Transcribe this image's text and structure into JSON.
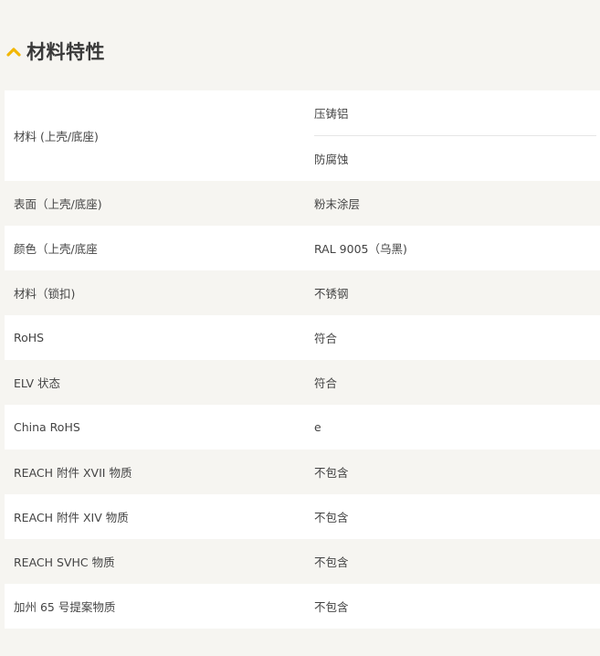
{
  "section": {
    "title": "材料特性",
    "icon": "chevron-up-icon",
    "accent_color": "#f2b705"
  },
  "rows": [
    {
      "label": "材料 (上壳/底座)",
      "values": [
        "压铸铝",
        "防腐蚀"
      ]
    },
    {
      "label": "表面（上壳/底座)",
      "values": [
        "粉末涂层"
      ]
    },
    {
      "label": "颜色（上壳/底座",
      "values": [
        "RAL 9005（乌黑)"
      ]
    },
    {
      "label": "材料（锁扣)",
      "values": [
        "不锈钢"
      ]
    },
    {
      "label": "RoHS",
      "values": [
        "符合"
      ]
    },
    {
      "label": "ELV 状态",
      "values": [
        "符合"
      ]
    },
    {
      "label": "China RoHS",
      "values": [
        "e"
      ]
    },
    {
      "label": "REACH 附件 XVII 物质",
      "values": [
        "不包含"
      ]
    },
    {
      "label": "REACH 附件 XIV 物质",
      "values": [
        "不包含"
      ]
    },
    {
      "label": "REACH SVHC 物质",
      "values": [
        "不包含"
      ]
    },
    {
      "label": "加州 65 号提案物质",
      "values": [
        "不包含"
      ]
    }
  ]
}
